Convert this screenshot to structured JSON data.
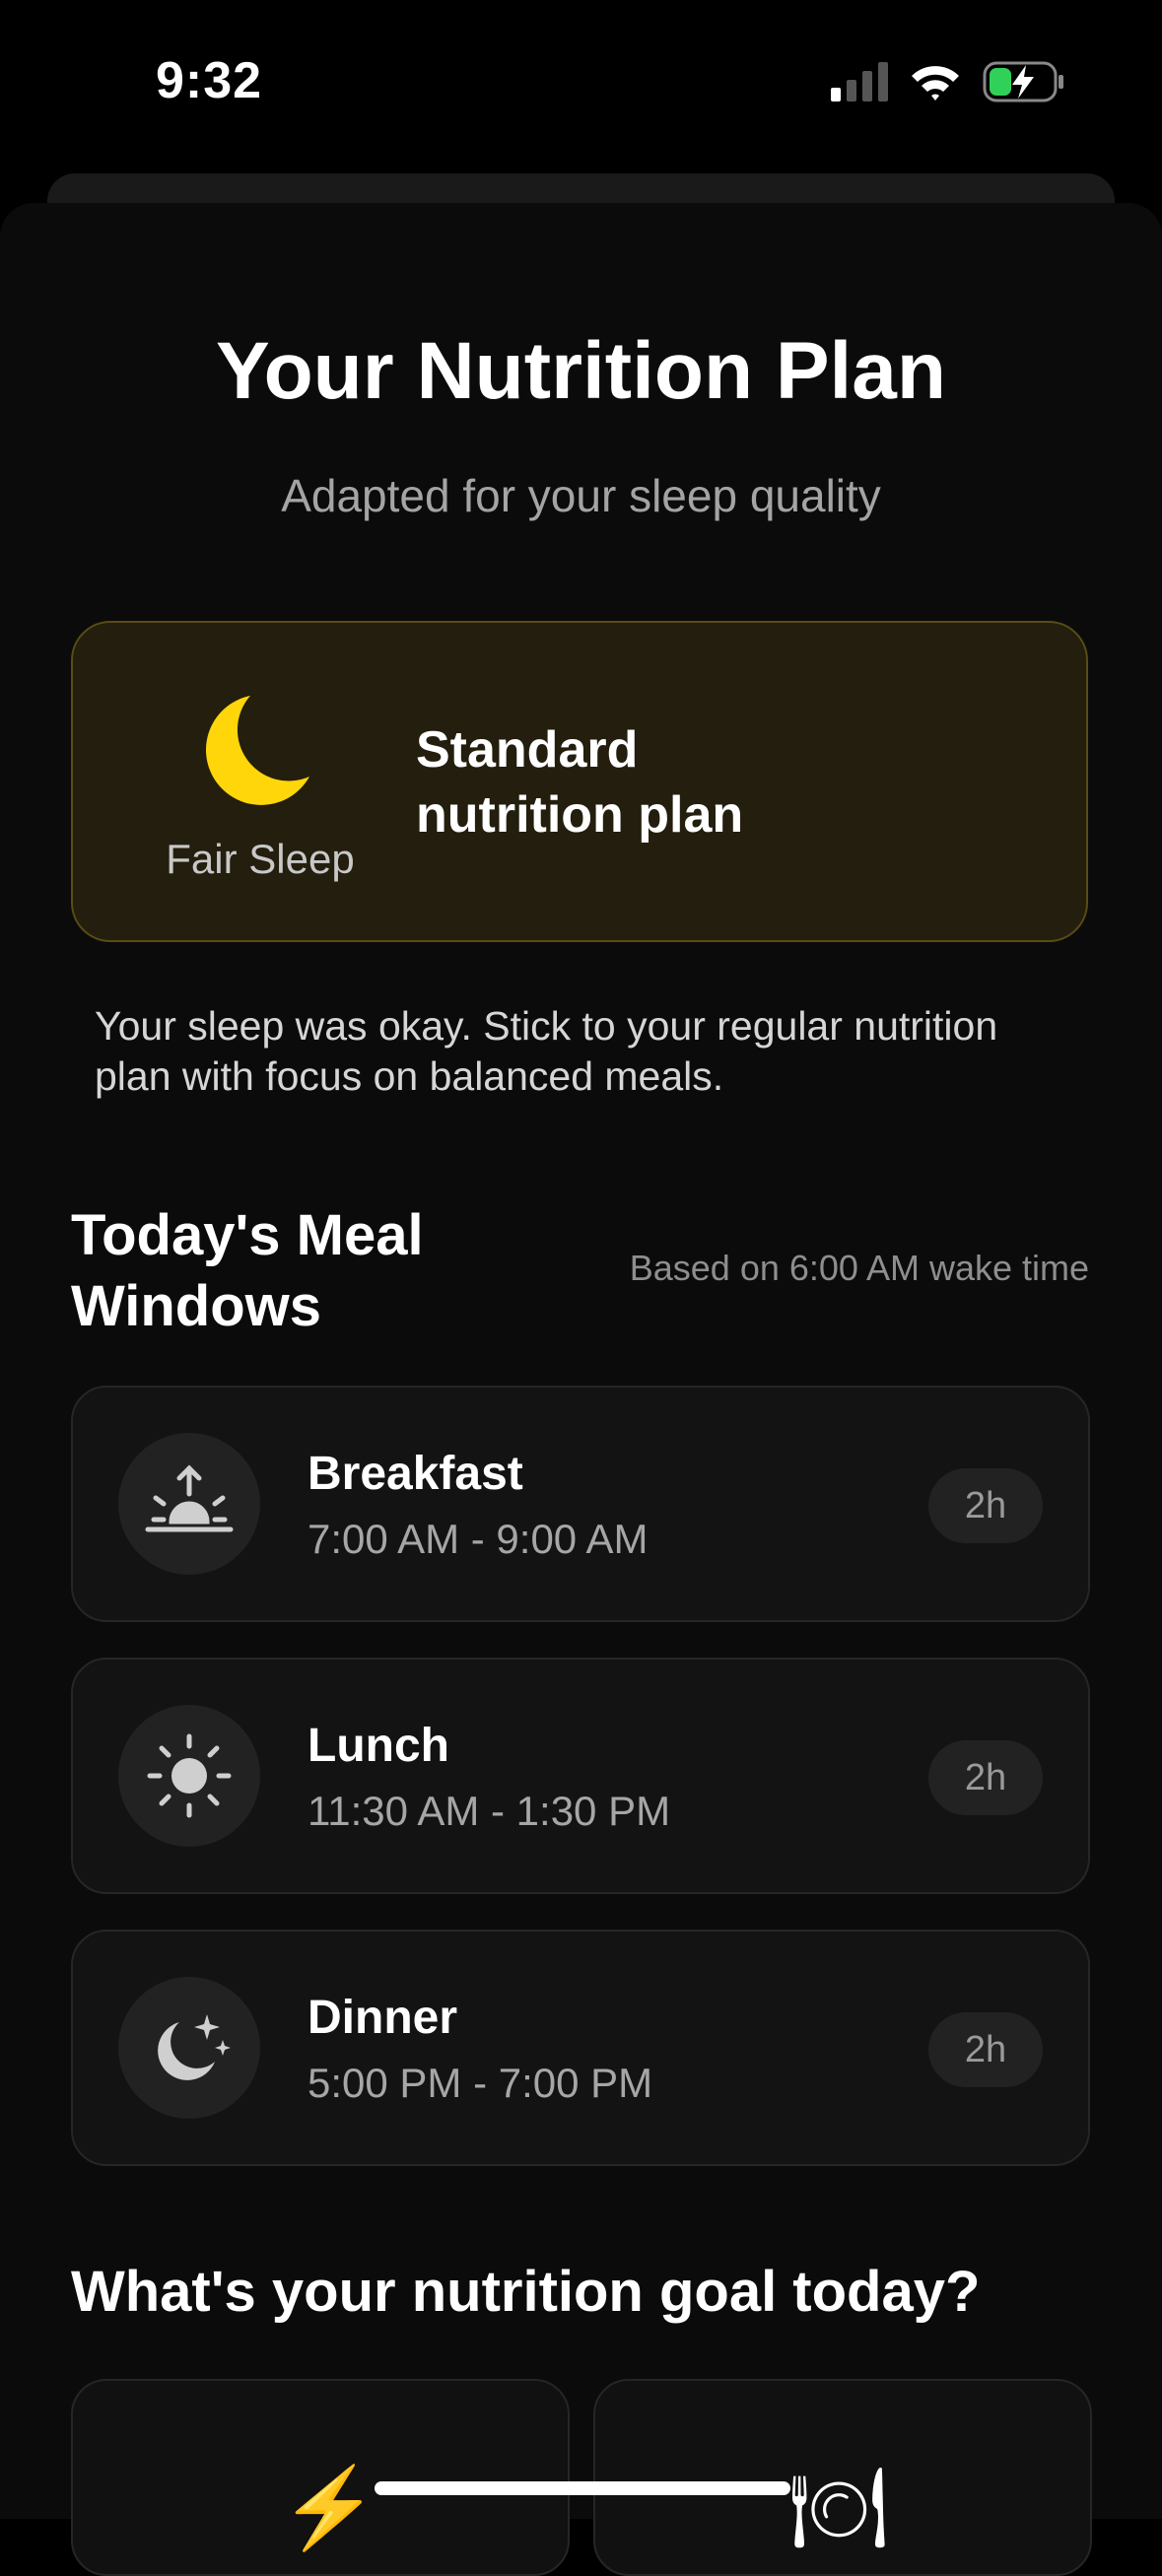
{
  "status_bar": {
    "time": "9:32"
  },
  "header": {
    "title": "Your Nutrition Plan",
    "subtitle": "Adapted for your sleep quality"
  },
  "sleep_card": {
    "icon": "moon-icon",
    "quality_label": "Fair Sleep",
    "plan_label": "Standard nutrition plan",
    "accent_color": "#FFD60A"
  },
  "description": "Your sleep was okay. Stick to your regular nutrition plan with focus on balanced meals.",
  "meal_windows": {
    "title": "Today's Meal Windows",
    "note": "Based on 6:00 AM wake time",
    "items": [
      {
        "name": "Breakfast",
        "time": "7:00 AM - 9:00 AM",
        "duration": "2h",
        "icon": "sunrise-icon"
      },
      {
        "name": "Lunch",
        "time": "11:30 AM - 1:30 PM",
        "duration": "2h",
        "icon": "sun-icon"
      },
      {
        "name": "Dinner",
        "time": "5:00 PM - 7:00 PM",
        "duration": "2h",
        "icon": "moon-stars-icon"
      }
    ]
  },
  "goal": {
    "title": "What's your nutrition goal today?",
    "options": [
      {
        "icon": "lightning-icon",
        "emoji": "⚡"
      },
      {
        "icon": "plate-icon",
        "emoji": "🍽"
      }
    ]
  }
}
